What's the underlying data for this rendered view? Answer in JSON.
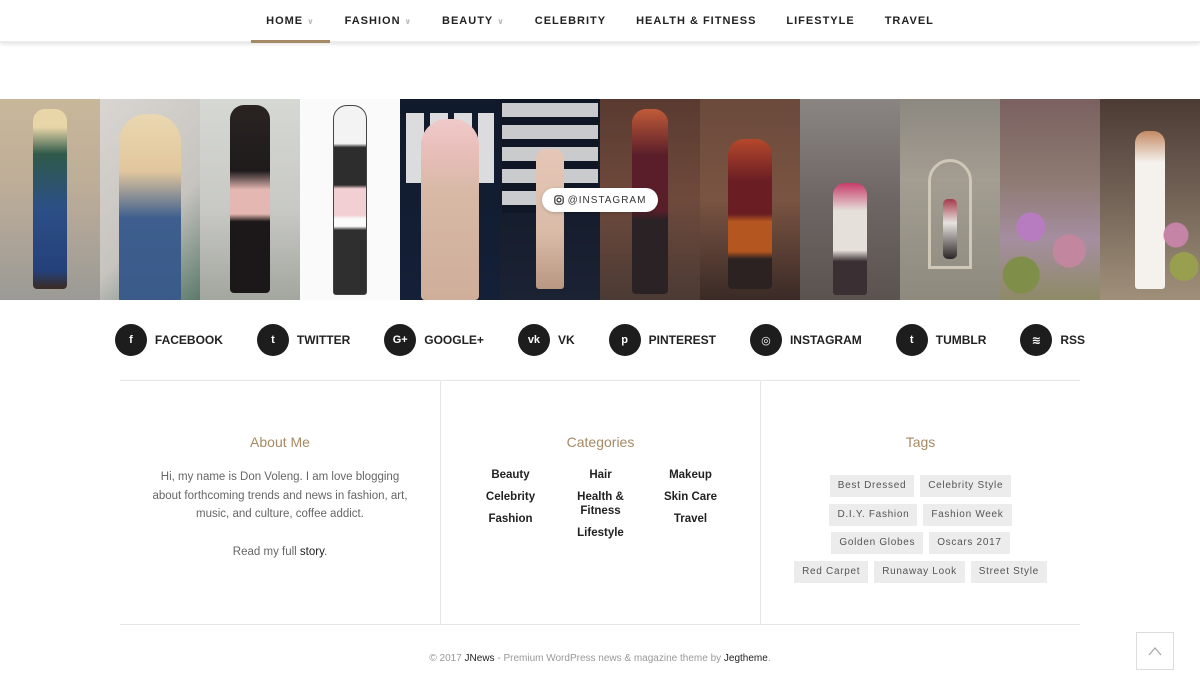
{
  "nav": {
    "items": [
      {
        "label": "HOME",
        "dropdown": true,
        "active": true
      },
      {
        "label": "FASHION",
        "dropdown": true
      },
      {
        "label": "BEAUTY",
        "dropdown": true
      },
      {
        "label": "CELEBRITY",
        "dropdown": false
      },
      {
        "label": "HEALTH & FITNESS",
        "dropdown": false
      },
      {
        "label": "LIFESTYLE",
        "dropdown": false
      },
      {
        "label": "TRAVEL",
        "dropdown": false
      }
    ],
    "chevron_glyph": "∨"
  },
  "instagram": {
    "badge_label": "@INSTAGRAM",
    "icon": "instagram-icon"
  },
  "social": [
    {
      "label": "FACEBOOK",
      "icon": "facebook-icon",
      "glyph": "f"
    },
    {
      "label": "TWITTER",
      "icon": "twitter-icon",
      "glyph": "t"
    },
    {
      "label": "GOOGLE+",
      "icon": "google-plus-icon",
      "glyph": "G+"
    },
    {
      "label": "VK",
      "icon": "vk-icon",
      "glyph": "vk"
    },
    {
      "label": "PINTEREST",
      "icon": "pinterest-icon",
      "glyph": "p"
    },
    {
      "label": "INSTAGRAM",
      "icon": "instagram-icon",
      "glyph": "◎"
    },
    {
      "label": "TUMBLR",
      "icon": "tumblr-icon",
      "glyph": "t"
    },
    {
      "label": "RSS",
      "icon": "rss-icon",
      "glyph": "≋"
    }
  ],
  "about": {
    "title": "About Me",
    "bio": "Hi, my name is Don Voleng. I am love blogging about forthcoming trends and news in fashion, art, music, and culture, coffee addict.",
    "read_prefix": "Read my full ",
    "read_link": "story",
    "read_suffix": "."
  },
  "categories": {
    "title": "Categories",
    "columns": [
      [
        "Beauty",
        "Celebrity",
        "Fashion"
      ],
      [
        "Hair",
        "Health &\nFitness",
        "Lifestyle"
      ],
      [
        "Makeup",
        "Skin Care",
        "Travel"
      ]
    ]
  },
  "tags": {
    "title": "Tags",
    "items": [
      "Best Dressed",
      "Celebrity Style",
      "D.I.Y. Fashion",
      "Fashion Week",
      "Golden Globes",
      "Oscars 2017",
      "Red Carpet",
      "Runaway Look",
      "Street Style"
    ]
  },
  "copyright": {
    "prefix": "© 2017 ",
    "brand": "JNews",
    "middle": " - Premium WordPress news & magazine theme by ",
    "author": "Jegtheme",
    "suffix": "."
  },
  "colors": {
    "accent": "#a68a64",
    "social_circle": "#1d1d1d"
  }
}
